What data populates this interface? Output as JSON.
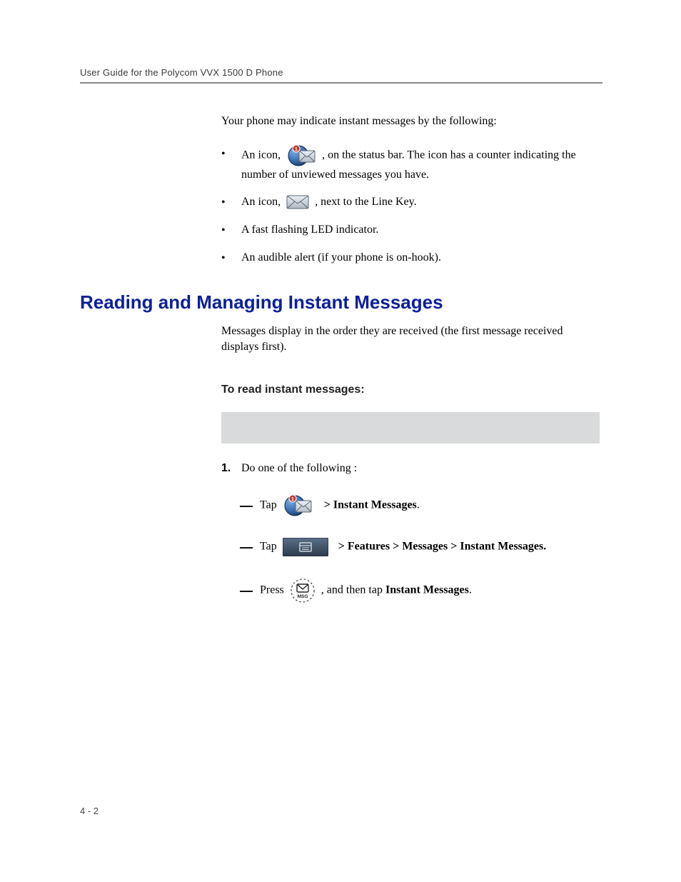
{
  "header": {
    "running": "User Guide for the Polycom VVX 1500 D Phone"
  },
  "body": {
    "intro": "Your phone may indicate instant messages by the following:",
    "bullets": {
      "b1_pre": "An icon, ",
      "b1_post": " , on the status bar. The icon has a counter indicating the number of unviewed messages you have.",
      "b2_pre": "An icon, ",
      "b2_post": " , next to the Line Key.",
      "b3": "A fast flashing LED indicator.",
      "b4": "An audible alert (if your phone is on-hook)."
    },
    "h2": "Reading and Managing Instant Messages",
    "h2_para": "Messages display in the order they are received (the first message received displays first).",
    "subhead": "To read instant messages:",
    "numlist": {
      "n1_marker": "1.",
      "n1_text": "Do one of the following :",
      "s1_pre": "Tap ",
      "s1_post_bold": "> Instant Messages",
      "s1_post_tail": ".",
      "s2_pre": "Tap ",
      "s2_bold": "> Features > Messages > Instant Messages.",
      "s3_pre": "Press ",
      "s3_mid": " , and then tap ",
      "s3_bold": "Instant Messages",
      "s3_tail": "."
    }
  },
  "footer": {
    "pagenum": "4 - 2"
  },
  "icons": {
    "badge_count": "1"
  }
}
